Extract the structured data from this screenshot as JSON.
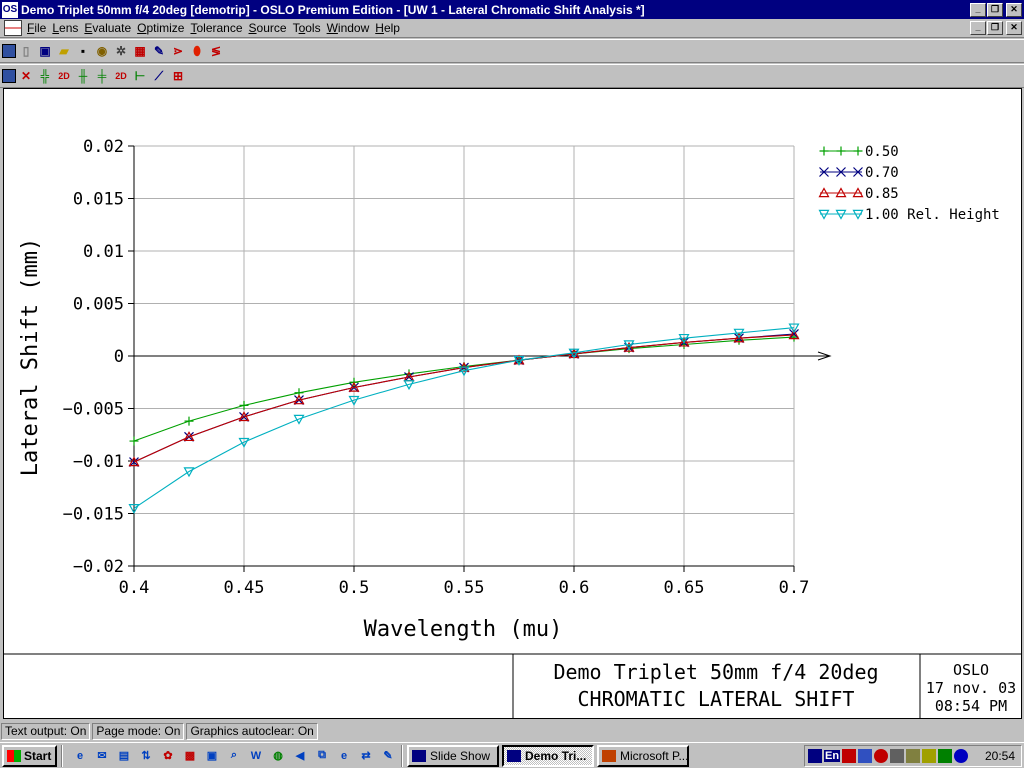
{
  "window": {
    "title": "Demo Triplet 50mm f/4 20deg [demotrip] - OSLO Premium Edition - [UW 1 - Lateral Chromatic Shift Analysis *]",
    "caption_buttons": [
      "_",
      "❐",
      "✕"
    ],
    "app_icon": "oslo-logo-icon"
  },
  "menu": {
    "items": [
      {
        "label": "File",
        "accel": "F"
      },
      {
        "label": "Lens",
        "accel": "L"
      },
      {
        "label": "Evaluate",
        "accel": "E"
      },
      {
        "label": "Optimize",
        "accel": "O"
      },
      {
        "label": "Tolerance",
        "accel": "T"
      },
      {
        "label": "Source",
        "accel": "S"
      },
      {
        "label": "Tools",
        "accel": "o"
      },
      {
        "label": "Window",
        "accel": "W"
      },
      {
        "label": "Help",
        "accel": "H"
      }
    ]
  },
  "toolbar1": {
    "icons": [
      "grid-icon",
      "pencil-icon",
      "new-icon",
      "open-folder-icon",
      "save-icon",
      "lens-data-icon",
      "settings-icon",
      "calculator-icon",
      "editor-icon",
      "ray-trace-icon",
      "lens-icon",
      "spot-icon"
    ]
  },
  "toolbar2": {
    "icons": [
      "grid-icon",
      "ray-fan-icon",
      "field-analysis-icon",
      "2d-icon",
      "ray-aberration-icon",
      "field-curves-icon",
      "2d-icon-b",
      "distortion-icon",
      "line-chart-icon",
      "spot-diagram-icon"
    ]
  },
  "chart_data": {
    "type": "line",
    "xlabel": "Wavelength (mu)",
    "ylabel": "Lateral Shift (mm)",
    "xlim": [
      0.4,
      0.7
    ],
    "ylim": [
      -0.02,
      0.02
    ],
    "x_ticks": [
      "0.4",
      "0.45",
      "0.5",
      "0.55",
      "0.6",
      "0.65",
      "0.7"
    ],
    "y_ticks": [
      "0.02",
      "0.015",
      "0.01",
      "0.005",
      "0",
      "−0.005",
      "−0.01",
      "−0.015",
      "−0.02"
    ],
    "grid": true,
    "legend_position": "top-right",
    "x": [
      0.4,
      0.425,
      0.45,
      0.475,
      0.5,
      0.525,
      0.55,
      0.575,
      0.6,
      0.625,
      0.65,
      0.675,
      0.7
    ],
    "series": [
      {
        "name": "0.50",
        "color": "#00a000",
        "marker": "plus",
        "values": [
          -0.0081,
          -0.0062,
          -0.0047,
          -0.0035,
          -0.0025,
          -0.0017,
          -0.001,
          -0.0004,
          0.0002,
          0.0007,
          0.0011,
          0.0015,
          0.0018
        ]
      },
      {
        "name": "0.70",
        "color": "#000080",
        "marker": "x",
        "values": [
          -0.0101,
          -0.0077,
          -0.0058,
          -0.0042,
          -0.003,
          -0.002,
          -0.0011,
          -0.0004,
          0.0002,
          0.0008,
          0.0013,
          0.0017,
          0.0021
        ]
      },
      {
        "name": "0.85",
        "color": "#c00000",
        "marker": "triangle-up",
        "values": [
          -0.0101,
          -0.0077,
          -0.0058,
          -0.0042,
          -0.003,
          -0.002,
          -0.0011,
          -0.0004,
          0.0002,
          0.0008,
          0.0013,
          0.0017,
          0.002
        ]
      },
      {
        "name": "1.00 Rel. Height",
        "color": "#00b0c0",
        "marker": "triangle-down",
        "values": [
          -0.0145,
          -0.011,
          -0.0082,
          -0.006,
          -0.0042,
          -0.0027,
          -0.0014,
          -0.0004,
          0.0003,
          0.0011,
          0.0017,
          0.0022,
          0.0027
        ]
      }
    ]
  },
  "caption": {
    "title_line1": "Demo Triplet 50mm f/4 20deg",
    "title_line2": "CHROMATIC LATERAL SHIFT",
    "program": "OSLO",
    "date": "17 nov. 03",
    "time": "08:54 PM"
  },
  "status": {
    "text_output": "Text output: On",
    "page_mode": "Page mode: On",
    "graphics_autoclear": "Graphics autoclear: On"
  },
  "taskbar": {
    "start_label": "Start",
    "quicklaunch_icons": [
      "ie-icon",
      "outlook-icon",
      "wordpad-icon",
      "ftp-icon",
      "paint-icon",
      "gift-icon",
      "image-icon",
      "search-icon",
      "word-icon",
      "globe-icon",
      "chat-icon",
      "network-icon",
      "ie-icon-b",
      "sync-icon",
      "notepad-icon"
    ],
    "tasks": [
      {
        "label": "Slide Show",
        "active": false
      },
      {
        "label": "Demo Tri...",
        "active": true
      },
      {
        "label": "Microsoft P...",
        "active": false
      }
    ],
    "tray_lang": "En",
    "clock": "20:54"
  }
}
